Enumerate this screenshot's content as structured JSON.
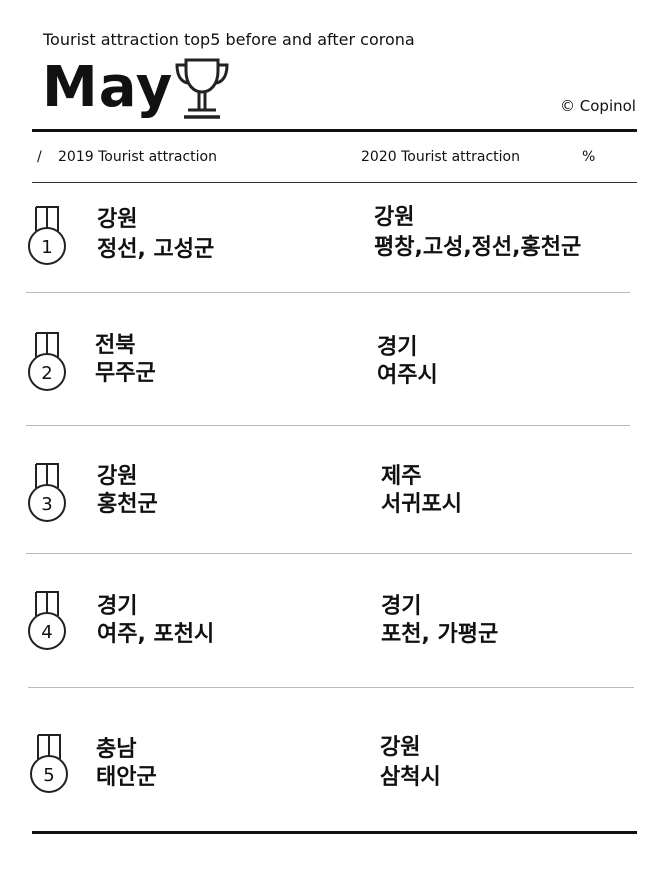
{
  "header": {
    "subtitle": "Tourist attraction top5 before and after corona",
    "month": "May",
    "copyright": "© Copinol"
  },
  "columns": {
    "slash": "/",
    "col_2019": "2019 Tourist attraction",
    "col_2020": "2020 Tourist attraction",
    "col_pct": "%"
  },
  "rows": [
    {
      "rank": "1",
      "y2019": {
        "region": "강원",
        "places": "정선, 고성군"
      },
      "y2020": {
        "region": "강원",
        "places": "평창,고성,정선,홍천군"
      }
    },
    {
      "rank": "2",
      "y2019": {
        "region": "전북",
        "places": "무주군"
      },
      "y2020": {
        "region": "경기",
        "places": "여주시"
      }
    },
    {
      "rank": "3",
      "y2019": {
        "region": "강원",
        "places": "홍천군"
      },
      "y2020": {
        "region": "제주",
        "places": "서귀포시"
      }
    },
    {
      "rank": "4",
      "y2019": {
        "region": "경기",
        "places": "여주, 포천시"
      },
      "y2020": {
        "region": "경기",
        "places": "포천, 가평군"
      }
    },
    {
      "rank": "5",
      "y2019": {
        "region": "충남",
        "places": "태안군"
      },
      "y2020": {
        "region": "강원",
        "places": "삼척시"
      }
    }
  ],
  "icons": {
    "trophy": "trophy-icon",
    "medal": "medal-icon"
  }
}
